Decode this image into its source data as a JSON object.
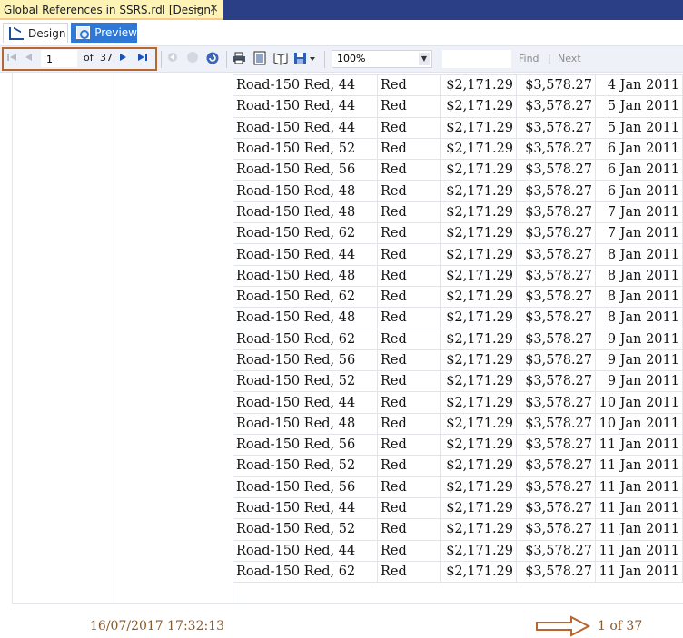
{
  "window": {
    "doc_tab_title": "Global References in SSRS.rdl [Design]",
    "pin_glyph": "⊸",
    "close_glyph": "×"
  },
  "view_tabs": {
    "design_label": "Design",
    "preview_label": "Preview",
    "active": "Preview"
  },
  "toolbar": {
    "current_page": "1",
    "of_label": "of",
    "total_pages": "37",
    "zoom_value": "100%",
    "find_label": "Find",
    "separator": "|",
    "next_label": "Next",
    "icons": [
      "first-page-icon",
      "previous-page-icon",
      "next-page-icon",
      "last-page-icon",
      "back-icon",
      "stop-icon",
      "refresh-icon",
      "print-icon",
      "print-layout-icon",
      "page-setup-icon",
      "export-icon"
    ]
  },
  "report": {
    "rows": [
      {
        "product": "Road-150 Red, 44",
        "color": "Red",
        "cost": "$2,171.29",
        "price": "$3,578.27",
        "date": "4 Jan 2011"
      },
      {
        "product": "Road-150 Red, 44",
        "color": "Red",
        "cost": "$2,171.29",
        "price": "$3,578.27",
        "date": "5 Jan 2011"
      },
      {
        "product": "Road-150 Red, 44",
        "color": "Red",
        "cost": "$2,171.29",
        "price": "$3,578.27",
        "date": "5 Jan 2011"
      },
      {
        "product": "Road-150 Red, 52",
        "color": "Red",
        "cost": "$2,171.29",
        "price": "$3,578.27",
        "date": "6 Jan 2011"
      },
      {
        "product": "Road-150 Red, 56",
        "color": "Red",
        "cost": "$2,171.29",
        "price": "$3,578.27",
        "date": "6 Jan 2011"
      },
      {
        "product": "Road-150 Red, 48",
        "color": "Red",
        "cost": "$2,171.29",
        "price": "$3,578.27",
        "date": "6 Jan 2011"
      },
      {
        "product": "Road-150 Red, 48",
        "color": "Red",
        "cost": "$2,171.29",
        "price": "$3,578.27",
        "date": "7 Jan 2011"
      },
      {
        "product": "Road-150 Red, 62",
        "color": "Red",
        "cost": "$2,171.29",
        "price": "$3,578.27",
        "date": "7 Jan 2011"
      },
      {
        "product": "Road-150 Red, 44",
        "color": "Red",
        "cost": "$2,171.29",
        "price": "$3,578.27",
        "date": "8 Jan 2011"
      },
      {
        "product": "Road-150 Red, 48",
        "color": "Red",
        "cost": "$2,171.29",
        "price": "$3,578.27",
        "date": "8 Jan 2011"
      },
      {
        "product": "Road-150 Red, 62",
        "color": "Red",
        "cost": "$2,171.29",
        "price": "$3,578.27",
        "date": "8 Jan 2011"
      },
      {
        "product": "Road-150 Red, 48",
        "color": "Red",
        "cost": "$2,171.29",
        "price": "$3,578.27",
        "date": "8 Jan 2011"
      },
      {
        "product": "Road-150 Red, 62",
        "color": "Red",
        "cost": "$2,171.29",
        "price": "$3,578.27",
        "date": "9 Jan 2011"
      },
      {
        "product": "Road-150 Red, 56",
        "color": "Red",
        "cost": "$2,171.29",
        "price": "$3,578.27",
        "date": "9 Jan 2011"
      },
      {
        "product": "Road-150 Red, 52",
        "color": "Red",
        "cost": "$2,171.29",
        "price": "$3,578.27",
        "date": "9 Jan 2011"
      },
      {
        "product": "Road-150 Red, 44",
        "color": "Red",
        "cost": "$2,171.29",
        "price": "$3,578.27",
        "date": "10 Jan 2011"
      },
      {
        "product": "Road-150 Red, 48",
        "color": "Red",
        "cost": "$2,171.29",
        "price": "$3,578.27",
        "date": "10 Jan 2011"
      },
      {
        "product": "Road-150 Red, 56",
        "color": "Red",
        "cost": "$2,171.29",
        "price": "$3,578.27",
        "date": "11 Jan 2011"
      },
      {
        "product": "Road-150 Red, 52",
        "color": "Red",
        "cost": "$2,171.29",
        "price": "$3,578.27",
        "date": "11 Jan 2011"
      },
      {
        "product": "Road-150 Red, 56",
        "color": "Red",
        "cost": "$2,171.29",
        "price": "$3,578.27",
        "date": "11 Jan 2011"
      },
      {
        "product": "Road-150 Red, 44",
        "color": "Red",
        "cost": "$2,171.29",
        "price": "$3,578.27",
        "date": "11 Jan 2011"
      },
      {
        "product": "Road-150 Red, 52",
        "color": "Red",
        "cost": "$2,171.29",
        "price": "$3,578.27",
        "date": "11 Jan 2011"
      },
      {
        "product": "Road-150 Red, 44",
        "color": "Red",
        "cost": "$2,171.29",
        "price": "$3,578.27",
        "date": "11 Jan 2011"
      },
      {
        "product": "Road-150 Red, 62",
        "color": "Red",
        "cost": "$2,171.29",
        "price": "$3,578.27",
        "date": "11 Jan 2011"
      }
    ],
    "execution_time": "16/07/2017 17:32:13",
    "page_footer": "1 of 37"
  },
  "colors": {
    "doc_tab_bg": "#fcf3b5",
    "tab_strip_bg": "#2b3f87",
    "preview_tab_bg": "#2f78d6",
    "annotation": "#b8652f",
    "footer_text": "#8b5a2b"
  }
}
